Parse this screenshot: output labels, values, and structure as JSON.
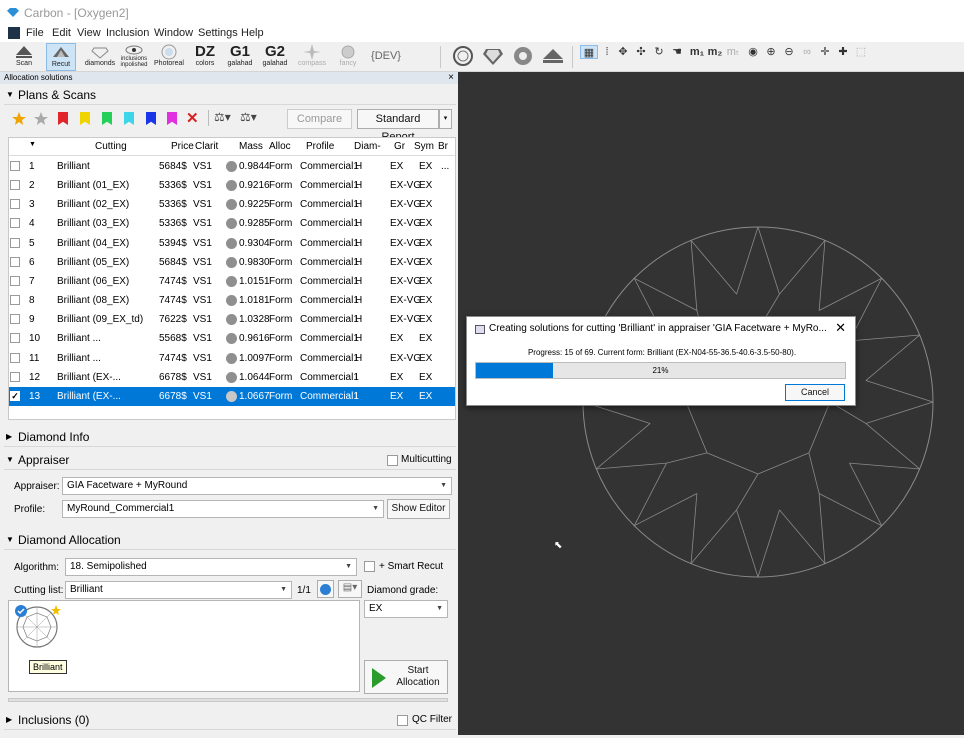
{
  "app": {
    "title": "Carbon - [Oxygen2]"
  },
  "menu": [
    "File",
    "Edit",
    "View",
    "Inclusion",
    "Window",
    "Settings",
    "Help"
  ],
  "toolbar": {
    "scan": "Scan",
    "recut": "Recut",
    "diamonds": "diamonds",
    "inclusions": "inclusions inpolished",
    "photoreal": "Photoreal",
    "dz_big": "DZ",
    "dz_small": "colors",
    "g1_big": "G1",
    "g1_small": "galahad",
    "g2_big": "G2",
    "g2_small": "galahad",
    "compass": "compass",
    "fancy": "fancy",
    "dev": "{DEV}"
  },
  "panel": {
    "title": "Allocation solutions",
    "close": "×"
  },
  "plans": {
    "section": "Plans & Scans",
    "compare": "Compare",
    "report": "Standard Report",
    "columns": [
      "Cutting",
      "Price",
      "Clarit",
      "Mass",
      "Alloc",
      "Profile",
      "Diam-",
      "Gr",
      "Sym",
      "Br"
    ],
    "rows": [
      {
        "n": "1",
        "cutting": "Brilliant",
        "price": "5684$",
        "clar": "VS1",
        "mass": "0.9844",
        "alloc": "Form",
        "profile": "Commercial1",
        "d": "H",
        "gr": "EX",
        "sym": "EX",
        "br": "...",
        "checked": false
      },
      {
        "n": "2",
        "cutting": "Brilliant (01_EX)",
        "price": "5336$",
        "clar": "VS1",
        "mass": "0.9216",
        "alloc": "Form",
        "profile": "Commercial1",
        "d": "H",
        "gr": "EX-VG",
        "sym": "EX",
        "br": "",
        "checked": false
      },
      {
        "n": "3",
        "cutting": "Brilliant (02_EX)",
        "price": "5336$",
        "clar": "VS1",
        "mass": "0.9225",
        "alloc": "Form",
        "profile": "Commercial1",
        "d": "H",
        "gr": "EX-VG",
        "sym": "EX",
        "br": "",
        "checked": false
      },
      {
        "n": "4",
        "cutting": "Brilliant (03_EX)",
        "price": "5336$",
        "clar": "VS1",
        "mass": "0.9285",
        "alloc": "Form",
        "profile": "Commercial1",
        "d": "H",
        "gr": "EX-VG",
        "sym": "EX",
        "br": "",
        "checked": false
      },
      {
        "n": "5",
        "cutting": "Brilliant (04_EX)",
        "price": "5394$",
        "clar": "VS1",
        "mass": "0.9304",
        "alloc": "Form",
        "profile": "Commercial1",
        "d": "H",
        "gr": "EX-VG",
        "sym": "EX",
        "br": "",
        "checked": false
      },
      {
        "n": "6",
        "cutting": "Brilliant (05_EX)",
        "price": "5684$",
        "clar": "VS1",
        "mass": "0.9830",
        "alloc": "Form",
        "profile": "Commercial1",
        "d": "H",
        "gr": "EX-VG",
        "sym": "EX",
        "br": "",
        "checked": false
      },
      {
        "n": "7",
        "cutting": "Brilliant (06_EX)",
        "price": "7474$",
        "clar": "VS1",
        "mass": "1.0151",
        "alloc": "Form",
        "profile": "Commercial1",
        "d": "H",
        "gr": "EX-VG",
        "sym": "EX",
        "br": "",
        "checked": false
      },
      {
        "n": "8",
        "cutting": "Brilliant (08_EX)",
        "price": "7474$",
        "clar": "VS1",
        "mass": "1.0181",
        "alloc": "Form",
        "profile": "Commercial1",
        "d": "H",
        "gr": "EX-VG",
        "sym": "EX",
        "br": "",
        "checked": false
      },
      {
        "n": "9",
        "cutting": "Brilliant (09_EX_td)",
        "price": "7622$",
        "clar": "VS1",
        "mass": "1.0328",
        "alloc": "Form",
        "profile": "Commercial1",
        "d": "H",
        "gr": "EX-VG",
        "sym": "EX",
        "br": "",
        "checked": false
      },
      {
        "n": "10",
        "cutting": "Brilliant ...",
        "price": "5568$",
        "clar": "VS1",
        "mass": "0.9616",
        "alloc": "Form",
        "profile": "Commercial1",
        "d": "H",
        "gr": "EX",
        "sym": "EX",
        "br": "",
        "checked": false
      },
      {
        "n": "11",
        "cutting": "Brilliant ...",
        "price": "7474$",
        "clar": "VS1",
        "mass": "1.0097",
        "alloc": "Form",
        "profile": "Commercial1",
        "d": "H",
        "gr": "EX-VG",
        "sym": "EX",
        "br": "",
        "checked": false
      },
      {
        "n": "12",
        "cutting": "Brilliant (EX-...",
        "price": "6678$",
        "clar": "VS1",
        "mass": "1.0644",
        "alloc": "Form",
        "profile": "Commercial1",
        "d": "I",
        "gr": "EX",
        "sym": "EX",
        "br": "",
        "checked": false
      },
      {
        "n": "13",
        "cutting": "Brilliant (EX-...",
        "price": "6678$",
        "clar": "VS1",
        "mass": "1.0667",
        "alloc": "Form",
        "profile": "Commercial1",
        "d": "I",
        "gr": "EX",
        "sym": "EX",
        "br": "",
        "checked": true
      }
    ]
  },
  "diamond_info": {
    "section": "Diamond Info"
  },
  "appraiser": {
    "section": "Appraiser",
    "multicutting": "Multicutting",
    "appraiser_label": "Appraiser:",
    "appraiser_value": "GIA Facetware + MyRound",
    "profile_label": "Profile:",
    "profile_value": "MyRound_Commercial1",
    "show_editor": "Show Editor"
  },
  "allocation": {
    "section": "Diamond Allocation",
    "algorithm_label": "Algorithm:",
    "algorithm_value": "18. Semipolished",
    "smart_recut": "+ Smart Recut",
    "cutting_list_label": "Cutting list:",
    "cutting_list_value": "Brilliant",
    "pager": "1/1",
    "grade_label": "Diamond grade:",
    "grade_value": "EX",
    "item_label": "Brilliant",
    "start": "Start Allocation"
  },
  "inclusions": {
    "section": "Inclusions (0)",
    "qc_filter": "QC Filter"
  },
  "dialog": {
    "title": "Creating solutions for cutting 'Brilliant' in appraiser 'GIA Facetware + MyRo...",
    "progress_text": "Progress: 15 of 69. Current form: Brilliant (EX-N04-55-36.5-40.6-3.5-50-80).",
    "percent": 21,
    "percent_label": "21%",
    "cancel": "Cancel"
  }
}
